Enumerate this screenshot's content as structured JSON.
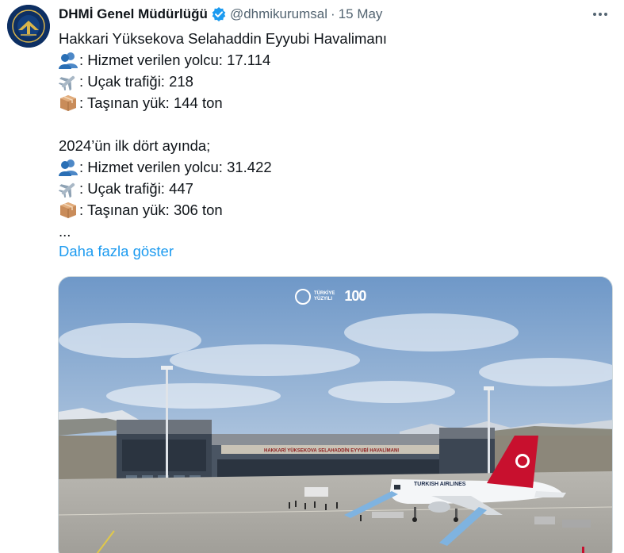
{
  "tweet": {
    "display_name": "DHMİ Genel Müdürlüğü",
    "handle": "@dhmikurumsal",
    "separator": "·",
    "date": "15 May",
    "avatar_icon": "dhmi-logo",
    "verified_icon": "verified-badge-icon",
    "more_icon": "more-horizontal-icon",
    "lines": [
      {
        "icon": "",
        "text": "Hakkari Yüksekova Selahaddin Eyyubi Havalimanı"
      },
      {
        "icon": "people-icon",
        "text": ": Hizmet verilen yolcu: 17.114"
      },
      {
        "icon": "airplane-icon",
        "text": ": Uçak trafiği: 218"
      },
      {
        "icon": "package-icon",
        "text": ": Taşınan yük: 144 ton"
      },
      {
        "icon": "",
        "text": ""
      },
      {
        "icon": "",
        "text": "2024’ün ilk dört ayında;"
      },
      {
        "icon": "people-icon",
        "text": ": Hizmet verilen yolcu: 31.422"
      },
      {
        "icon": "airplane-icon",
        "text": ": Uçak trafiği: 447"
      },
      {
        "icon": "package-icon",
        "text": ": Taşınan yük: 306 ton"
      },
      {
        "icon": "",
        "text": "..."
      }
    ],
    "show_more": "Daha fazla göster"
  },
  "media": {
    "logo_left_line1": "TÜRKİYE",
    "logo_left_line2": "YÜZYILI",
    "logo_right": "100",
    "terminal_sign": "HAKKARİ YÜKSEKOVA SELAHADDİN EYYUBİ HAVALİMANI",
    "aircraft_livery": "TURKISH AIRLINES",
    "colors": {
      "sky": "#8fb2d6",
      "tail": "#c8102e",
      "terminal": "#3a4552"
    }
  }
}
